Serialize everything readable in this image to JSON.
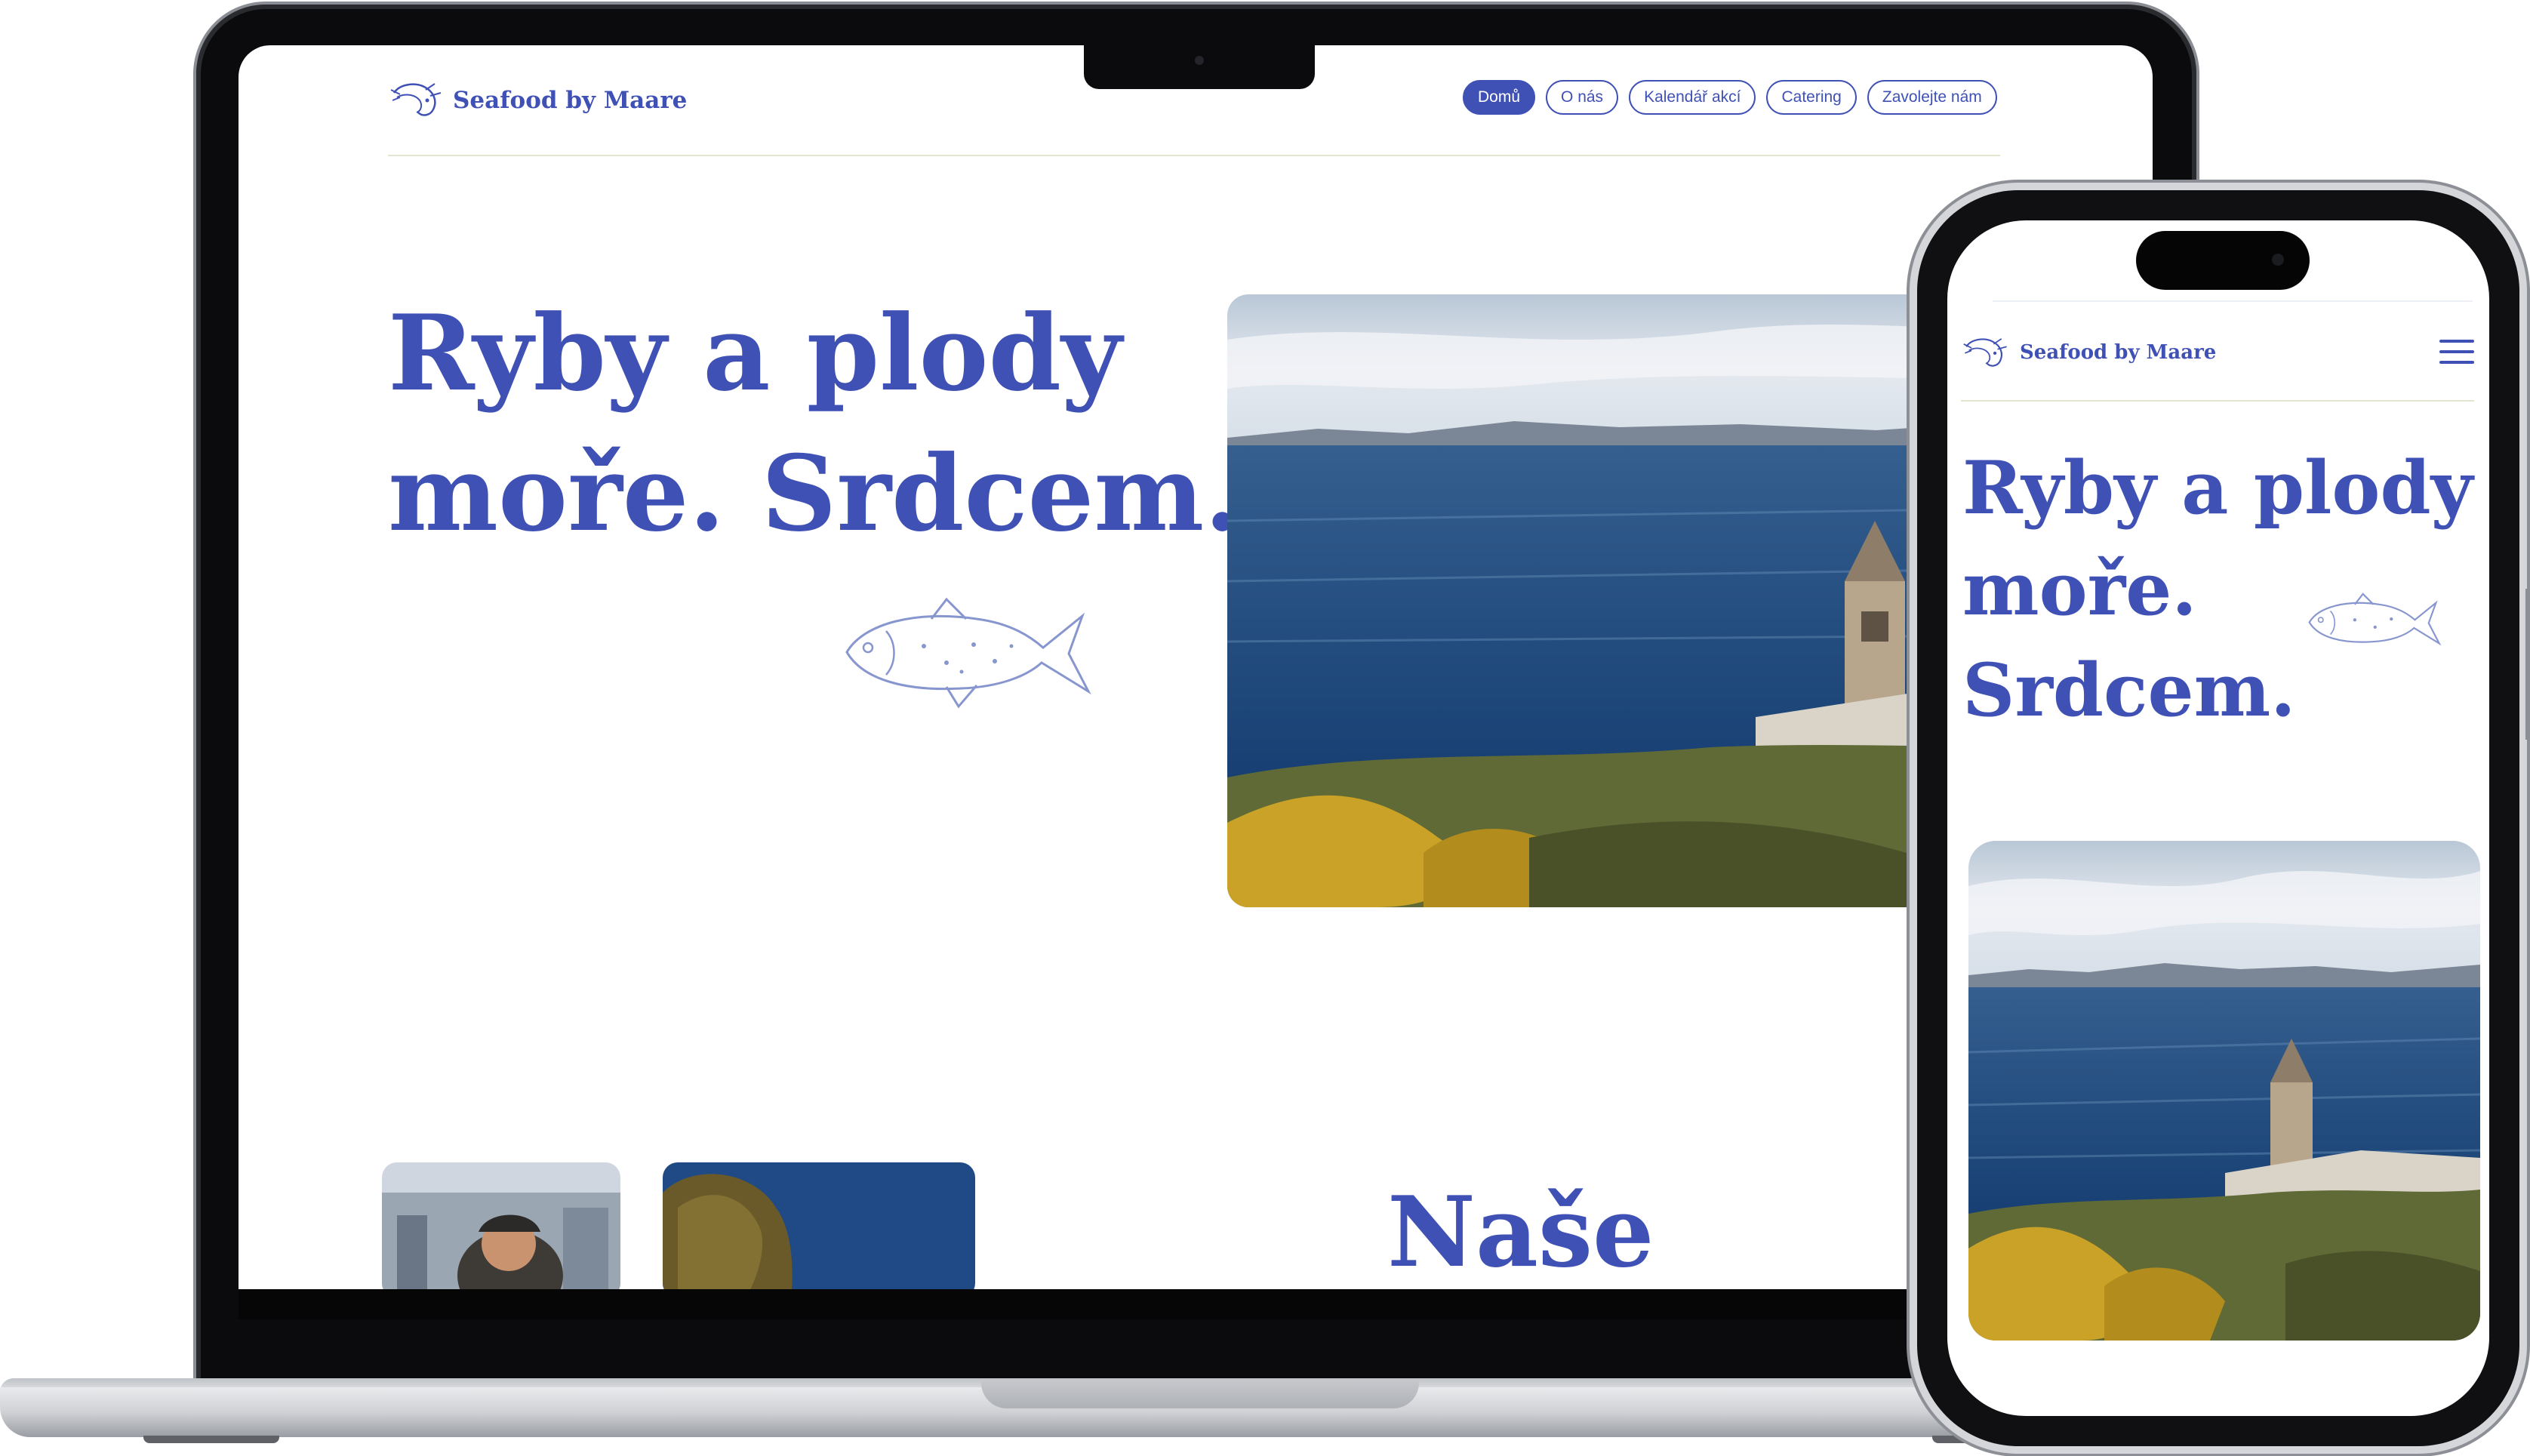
{
  "brand": {
    "name": "Seafood by Maare"
  },
  "nav": {
    "items": [
      {
        "label": "Domů",
        "active": true
      },
      {
        "label": "O nás",
        "active": false
      },
      {
        "label": "Kalendář akcí",
        "active": false
      },
      {
        "label": "Catering",
        "active": false
      },
      {
        "label": "Zavolejte nám",
        "active": false
      }
    ]
  },
  "hero": {
    "desktop_line1": "Ryby a plody",
    "desktop_line2": "moře. Srdcem.",
    "mobile_line1": "Ryby a plody",
    "mobile_line2": "moře.",
    "mobile_line3": "Srdcem."
  },
  "section": {
    "heading_partial": "Naše"
  },
  "icons": {
    "logo": "shrimp-logo-icon",
    "fish": "fish-illustration-icon",
    "menu": "hamburger-menu-icon",
    "camera": "camera-icon"
  },
  "colors": {
    "brand": "#3f51b5",
    "rule": "#e3e6cf",
    "sea": "#1f4f86",
    "sky": "#c7d6e6"
  }
}
